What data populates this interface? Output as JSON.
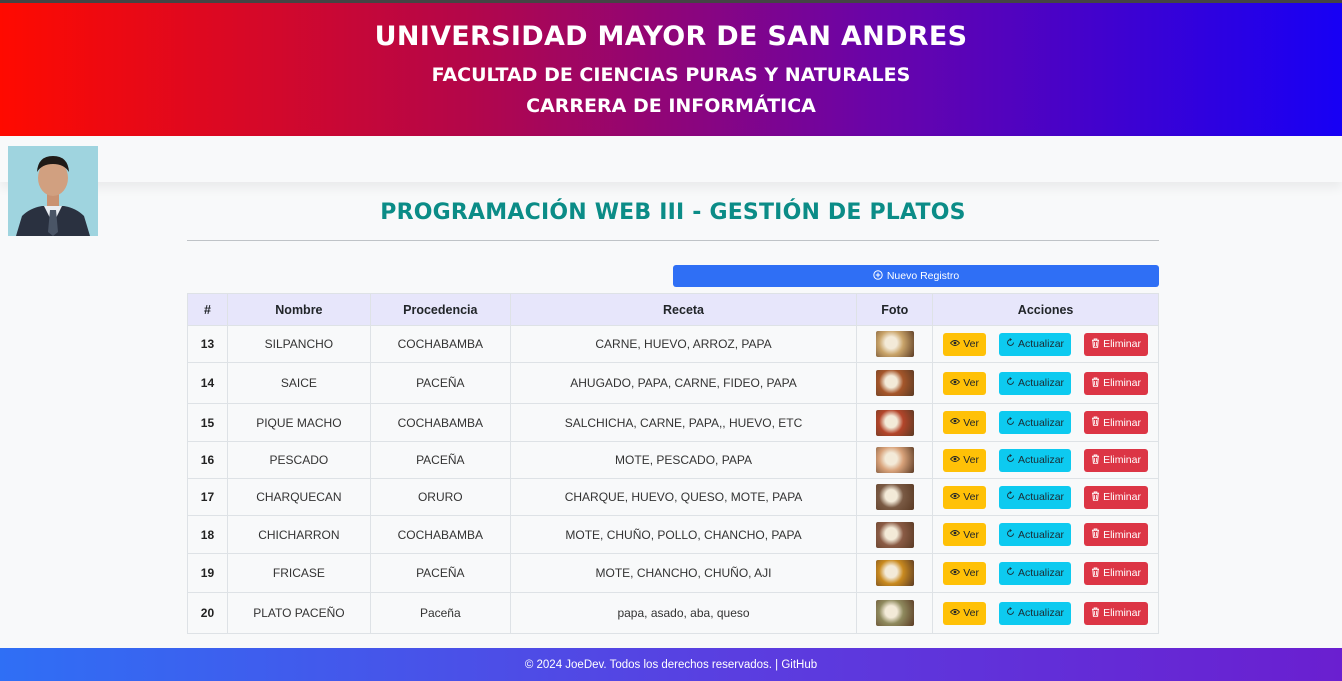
{
  "header": {
    "university": "UNIVERSIDAD MAYOR DE SAN ANDRES",
    "faculty": "FACULTAD DE CIENCIAS PURAS Y NATURALES",
    "career": "CARRERA DE INFORMÁTICA"
  },
  "page_title": "PROGRAMACIÓN WEB III - GESTIÓN DE PLATOS",
  "new_button": {
    "icon": "plus-circle-icon",
    "label": "Nuevo Registro"
  },
  "table": {
    "columns": [
      "#",
      "Nombre",
      "Procedencia",
      "Receta",
      "Foto",
      "Acciones"
    ],
    "rows": [
      {
        "id": "13",
        "nombre": "SILPANCHO",
        "procedencia": "COCHABAMBA",
        "receta": "CARNE, HUEVO, ARROZ, PAPA",
        "photo_color": "#c9a46a"
      },
      {
        "id": "14",
        "nombre": "SAICE",
        "procedencia": "PACEÑA",
        "receta": "AHUGADO, PAPA, CARNE, FIDEO, PAPA",
        "photo_color": "#a5562a"
      },
      {
        "id": "15",
        "nombre": "PIQUE MACHO",
        "procedencia": "COCHABAMBA",
        "receta": "SALCHICHA, CARNE, PAPA,, HUEVO, ETC",
        "photo_color": "#b3452a"
      },
      {
        "id": "16",
        "nombre": "PESCADO",
        "procedencia": "PACEÑA",
        "receta": "MOTE, PESCADO, PAPA",
        "photo_color": "#d8a27a"
      },
      {
        "id": "17",
        "nombre": "CHARQUECAN",
        "procedencia": "ORURO",
        "receta": "CHARQUE, HUEVO, QUESO, MOTE, PAPA",
        "photo_color": "#7a5a44"
      },
      {
        "id": "18",
        "nombre": "CHICHARRON",
        "procedencia": "COCHABAMBA",
        "receta": "MOTE, CHUÑO, POLLO, CHANCHO, PAPA",
        "photo_color": "#8a5b45"
      },
      {
        "id": "19",
        "nombre": "FRICASE",
        "procedencia": "PACEÑA",
        "receta": "MOTE, CHANCHO, CHUÑO, AJI",
        "photo_color": "#c98a1f"
      },
      {
        "id": "20",
        "nombre": "PLATO PACEÑO",
        "procedencia": "Paceña",
        "receta": "papa, asado, aba, queso",
        "photo_color": "#8f8a5e"
      }
    ]
  },
  "actions": {
    "ver": {
      "label": "Ver",
      "icon": "eye-icon",
      "color": "#ffc107"
    },
    "actualizar": {
      "label": "Actualizar",
      "icon": "refresh-icon",
      "color": "#0dcaf0"
    },
    "eliminar": {
      "label": "Eliminar",
      "icon": "trash-icon",
      "color": "#dc3545"
    }
  },
  "footer": {
    "text": "© 2024 JoeDev. Todos los derechos reservados. | GitHub"
  },
  "colors": {
    "title": "#0b8c87",
    "primary": "#2f6ff5",
    "header_left": "#ff0a00",
    "header_right": "#1700f5"
  }
}
